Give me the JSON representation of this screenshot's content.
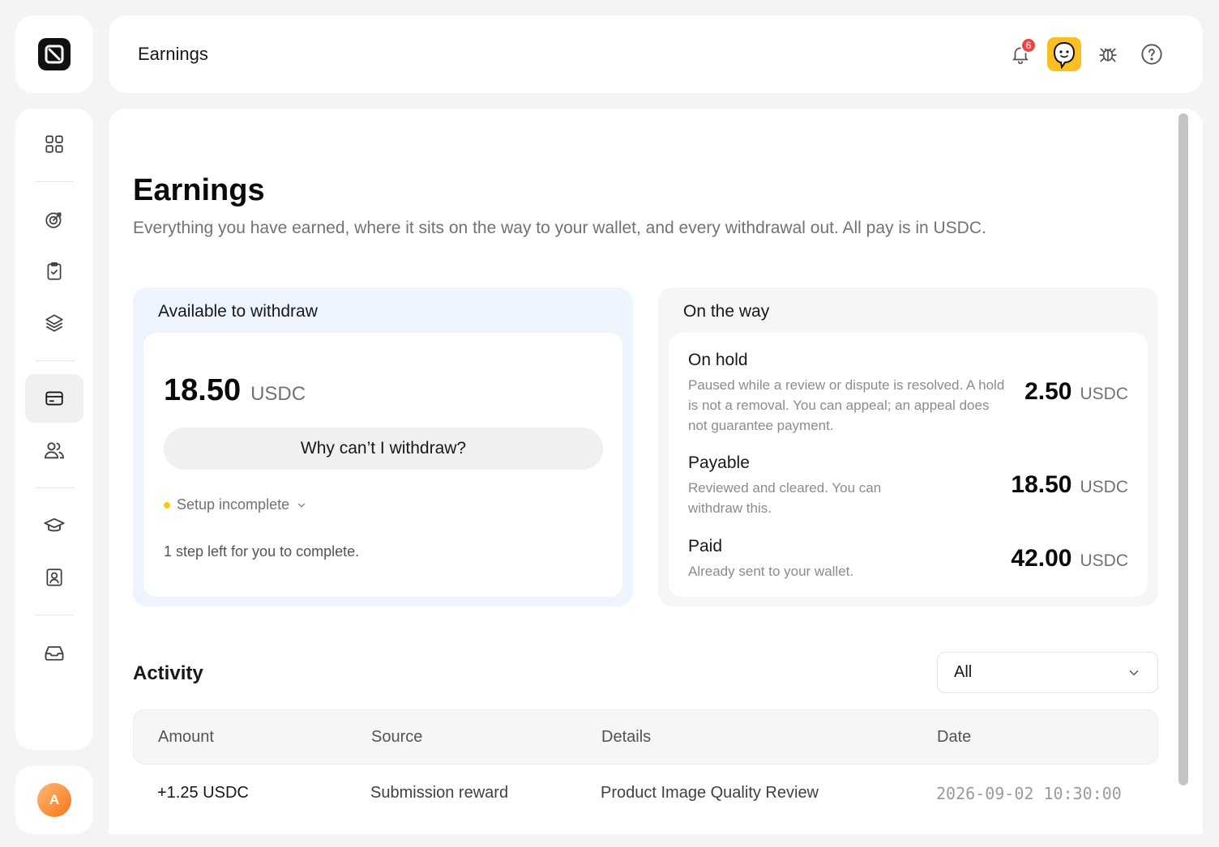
{
  "header": {
    "title": "Earnings",
    "notification_count": "6"
  },
  "user": {
    "initial": "A"
  },
  "page": {
    "title": "Earnings",
    "subtitle": "Everything you have earned, where it sits on the way to your wallet, and every withdrawal out. All pay is in USDC."
  },
  "available": {
    "title": "Available to withdraw",
    "amount": "18.50",
    "unit": "USDC",
    "why_button": "Why can’t I withdraw?",
    "setup_status": "Setup incomplete",
    "steps_text": "1 step left for you to complete."
  },
  "on_the_way": {
    "title": "On the way",
    "items": [
      {
        "label": "On hold",
        "description": "Paused while a review or dispute is resolved. A hold is not a removal. You can appeal; an appeal does not guarantee payment.",
        "amount": "2.50",
        "unit": "USDC"
      },
      {
        "label": "Payable",
        "description": "Reviewed and cleared. You can withdraw this.",
        "amount": "18.50",
        "unit": "USDC"
      },
      {
        "label": "Paid",
        "description": "Already sent to your wallet.",
        "amount": "42.00",
        "unit": "USDC"
      }
    ]
  },
  "activity": {
    "title": "Activity",
    "filter_value": "All",
    "columns": [
      "Amount",
      "Source",
      "Details",
      "Date"
    ],
    "rows": [
      {
        "amount": "+1.25 USDC",
        "source": "Submission reward",
        "details": "Product Image Quality Review",
        "date": "2026-09-02 10:30:00"
      }
    ]
  },
  "sidebar": {
    "icons": [
      "grid-icon",
      "target-icon",
      "clipboard-check-icon",
      "layers-icon",
      "credit-card-icon",
      "users-icon",
      "graduation-cap-icon",
      "contact-icon",
      "inbox-icon"
    ]
  },
  "colors": {
    "available_bg": "#edf4fe",
    "status_dot": "#facc15",
    "badge": "#ef4444",
    "avatar_face": "#fbbf24",
    "user_avatar": "#f97316"
  }
}
